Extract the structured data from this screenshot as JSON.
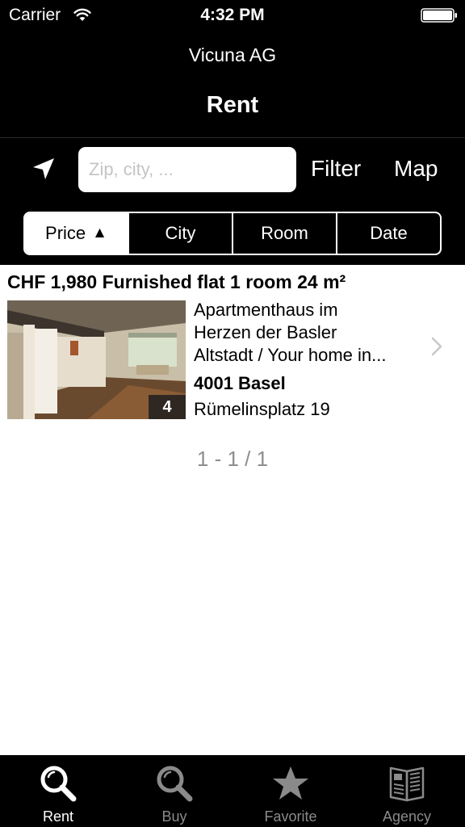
{
  "status_bar": {
    "carrier": "Carrier",
    "time": "4:32 PM"
  },
  "header": {
    "company": "Vicuna AG",
    "title": "Rent"
  },
  "search": {
    "placeholder": "Zip, city, ...",
    "value": "",
    "filter_label": "Filter",
    "map_label": "Map"
  },
  "sort": {
    "options": [
      "Price",
      "City",
      "Room",
      "Date"
    ],
    "selected": "Price",
    "direction_glyph": "▲"
  },
  "listings": [
    {
      "title": "CHF 1,980 Furnished flat 1 room 24 m²",
      "description_lines": [
        "Apartmenthaus im",
        "Herzen der Basler",
        "Altstadt / Your home in..."
      ],
      "photo_count": "4",
      "city": "4001 Basel",
      "street": "Rümelinsplatz 19"
    }
  ],
  "pagination": "1 - 1 / 1",
  "tabs": [
    {
      "label": "Rent",
      "icon": "search-icon",
      "active": true
    },
    {
      "label": "Buy",
      "icon": "search-icon",
      "active": false
    },
    {
      "label": "Favorite",
      "icon": "star-icon",
      "active": false
    },
    {
      "label": "Agency",
      "icon": "book-icon",
      "active": false
    }
  ],
  "colors": {
    "header_bg": "#000000",
    "accent": "#ffffff",
    "inactive_tab": "#8a8a8a",
    "pagination": "#8e8e8e"
  }
}
